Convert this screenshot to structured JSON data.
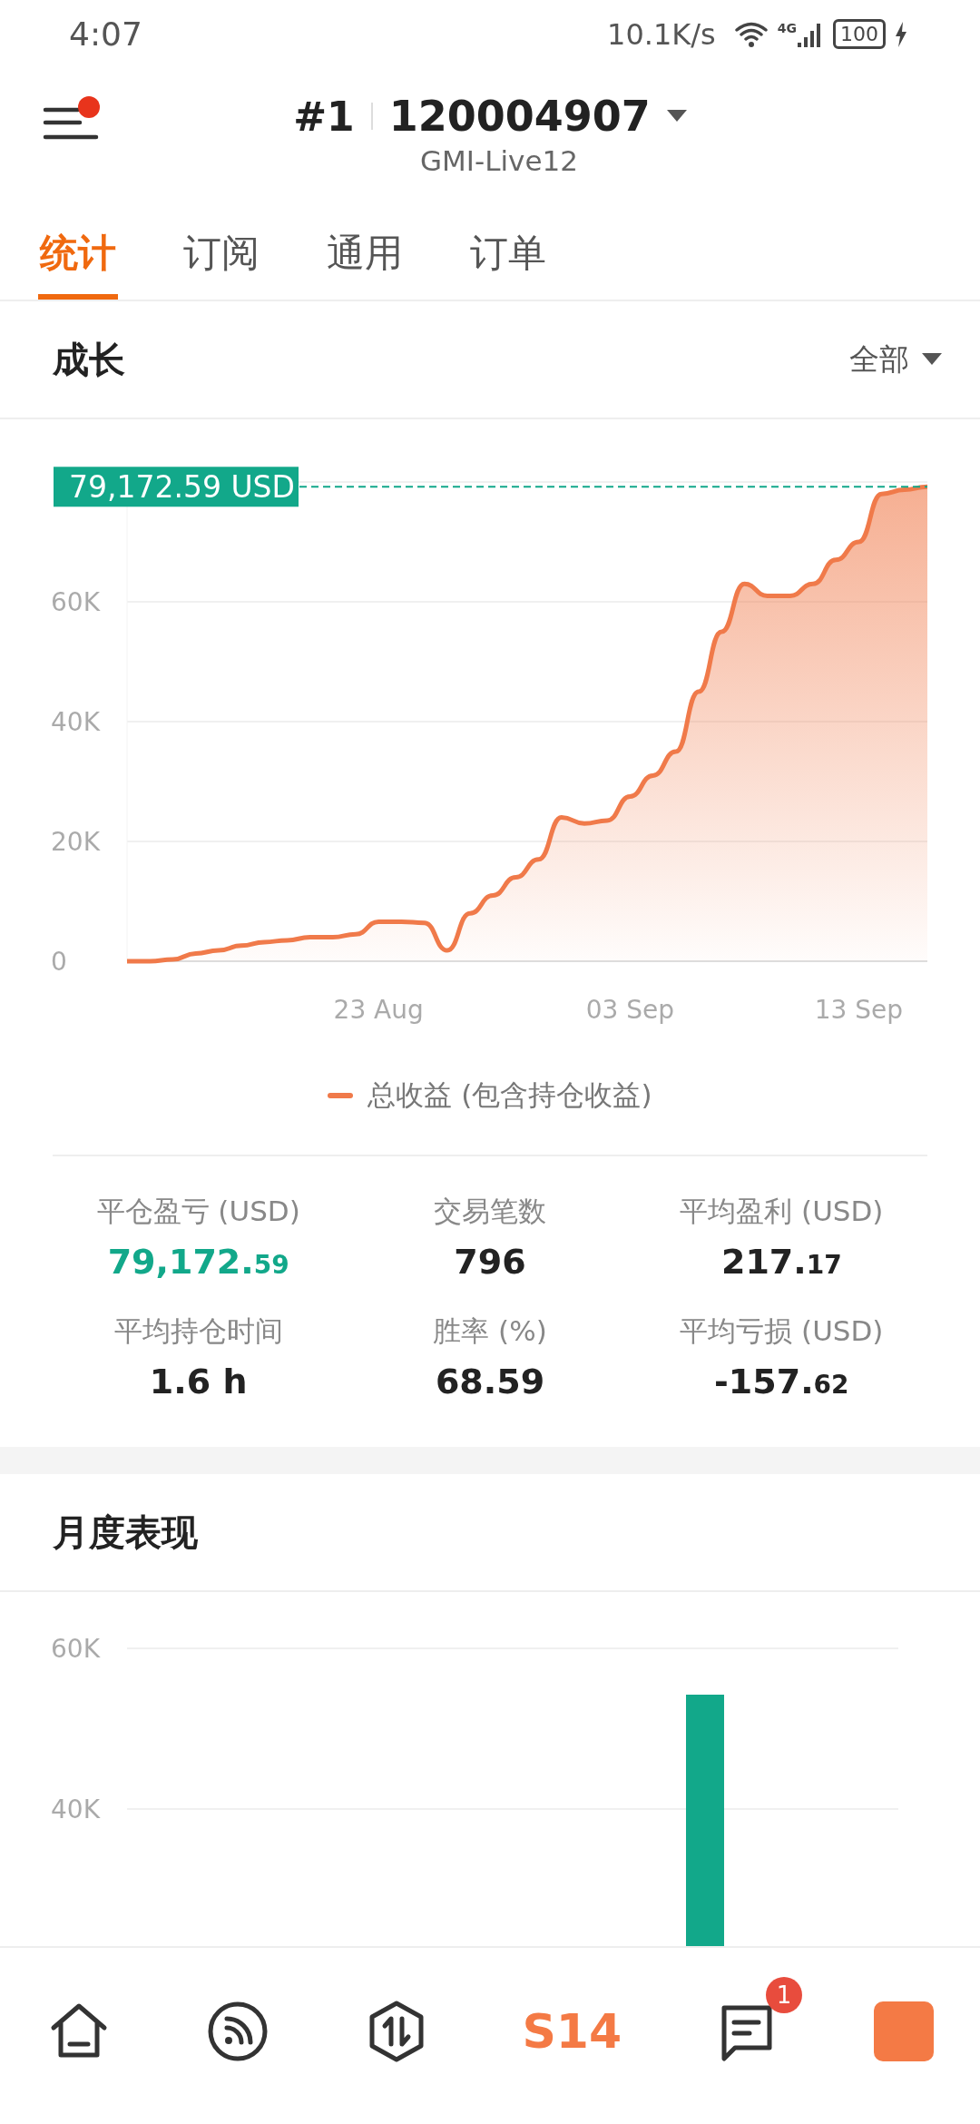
{
  "status_bar": {
    "time": "4:07",
    "speed": "10.1K/s",
    "network": "4G",
    "battery": "100"
  },
  "header": {
    "account_index": "#1",
    "account_number": "120004907",
    "server": "GMI-Live12",
    "menu_notification": true
  },
  "tabs": [
    {
      "label": "统计",
      "selected": true
    },
    {
      "label": "订阅",
      "selected": false
    },
    {
      "label": "通用",
      "selected": false
    },
    {
      "label": "订单",
      "selected": false
    }
  ],
  "growth": {
    "title": "成长",
    "filter": "全部",
    "chart_data": {
      "type": "area",
      "categories": [
        null,
        null,
        null,
        null,
        null,
        null,
        null,
        null,
        null,
        null,
        null,
        "23 Aug",
        null,
        null,
        null,
        null,
        null,
        null,
        null,
        null,
        null,
        null,
        "03 Sep",
        null,
        null,
        null,
        null,
        null,
        null,
        null,
        null,
        null,
        "13 Sep",
        null,
        null,
        null
      ],
      "series": [
        {
          "name": "总收益 (包含持仓收益)",
          "color": "#f07a4a",
          "values": [
            0,
            0,
            300,
            1300,
            1800,
            2600,
            3200,
            3500,
            4000,
            4000,
            4500,
            6600,
            6600,
            6400,
            1800,
            8000,
            11000,
            14000,
            17000,
            24000,
            23000,
            23500,
            27500,
            31000,
            35000,
            45000,
            55000,
            63000,
            61000,
            61000,
            63000,
            67000,
            70000,
            78000,
            78700,
            79200
          ]
        }
      ],
      "grid": true,
      "ylim": [
        0,
        80000
      ],
      "yticks": [
        0,
        {
          "value": 20000,
          "label": "20K"
        },
        {
          "value": 40000,
          "label": "40K"
        },
        {
          "value": 60000,
          "label": "60K"
        }
      ],
      "ref_lines": [
        {
          "label": "79,172.59 USD"
        }
      ]
    }
  },
  "stats": [
    {
      "label": "平仓盈亏 (USD)",
      "value": "79,172.",
      "decimals": "59",
      "color": "#12a88a"
    },
    {
      "label": "交易笔数",
      "value": "796",
      "color": "#222222"
    },
    {
      "label": "平均盈利 (USD)",
      "value": "217.",
      "decimals": "17",
      "color": "#222222"
    },
    {
      "label": "平均持仓时间",
      "value": "1.6 h",
      "color": "#222222"
    },
    {
      "label": "胜率 (%)",
      "value": "68.59",
      "color": "#222222"
    },
    {
      "label": "平均亏损 (USD)",
      "value": "-157.",
      "decimals": "62",
      "color": "#222222"
    }
  ],
  "monthly": {
    "title": "月度表现",
    "axis_labels": [
      "60K",
      "40K"
    ]
  },
  "bottom_nav": [
    {
      "kind": "home"
    },
    {
      "kind": "feed"
    },
    {
      "kind": "trade"
    },
    {
      "kind": "text",
      "label": "S14"
    },
    {
      "kind": "chat",
      "badge": "1"
    },
    {
      "kind": "app"
    }
  ]
}
